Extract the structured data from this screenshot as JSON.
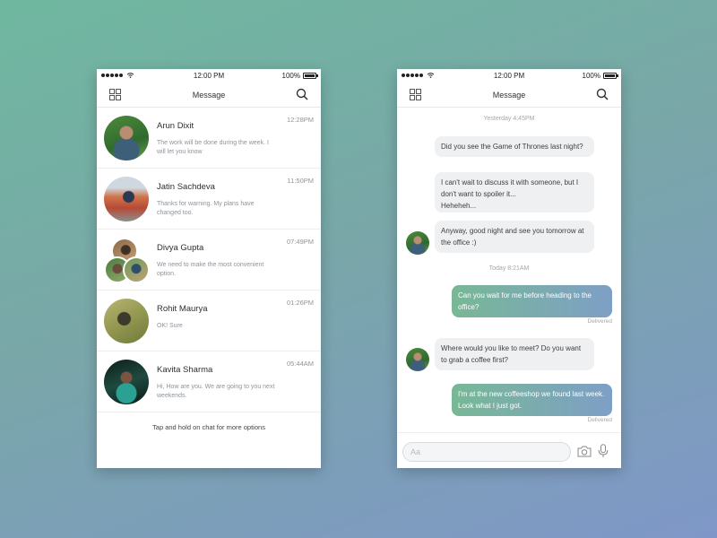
{
  "status_bar": {
    "time": "12:00 PM",
    "battery": "100%"
  },
  "list_screen": {
    "title": "Message",
    "chats": [
      {
        "name": "Arun Dixit",
        "preview": "The work will be done during the week. I will let you know",
        "time": "12:28PM"
      },
      {
        "name": "Jatin Sachdeva",
        "preview": "Thanks for warning. My plans have changed too.",
        "time": "11:50PM"
      },
      {
        "name": "Divya Gupta",
        "preview": "We need to make the most convenient option.",
        "time": "07:49PM"
      },
      {
        "name": "Rohit Maurya",
        "preview": "OK! Sure",
        "time": "01:26PM"
      },
      {
        "name": "Kavita Sharma",
        "preview": "Hi, How are you. We are going to you next weekends.",
        "time": "05:44AM"
      }
    ],
    "hint": "Tap and hold on chat for more options"
  },
  "chat_screen": {
    "title": "Message",
    "day1": "Yesterday 4:45PM",
    "day2": "Today 8:21AM",
    "msg1": "Did you see the Game of Thrones last night?",
    "msg2a": "I can't wait to discuss it with someone, but I don't want to spoiler it...",
    "msg2b": "Heheheh...",
    "msg3": "Anyway, good night and see you tomorrow at the office :)",
    "msg4": "Can you wait for me before heading to the office?",
    "status4": "Delivered",
    "msg5": "Where would you like to meet? Do you want to grab a coffee first?",
    "msg6": "I'm at the new coffeeshop we found last week. Look what I just got.",
    "status6": "Delivered",
    "input_placeholder": "Aa"
  },
  "colors": {
    "outgoing_start": "#78b896",
    "outgoing_end": "#7e9fc6",
    "incoming": "#eff0f2",
    "background_start": "#6fb89f",
    "background_end": "#7f97c8"
  },
  "icons": [
    "grid-icon",
    "search-icon",
    "camera-icon",
    "mic-icon",
    "wifi-icon",
    "battery-icon"
  ]
}
